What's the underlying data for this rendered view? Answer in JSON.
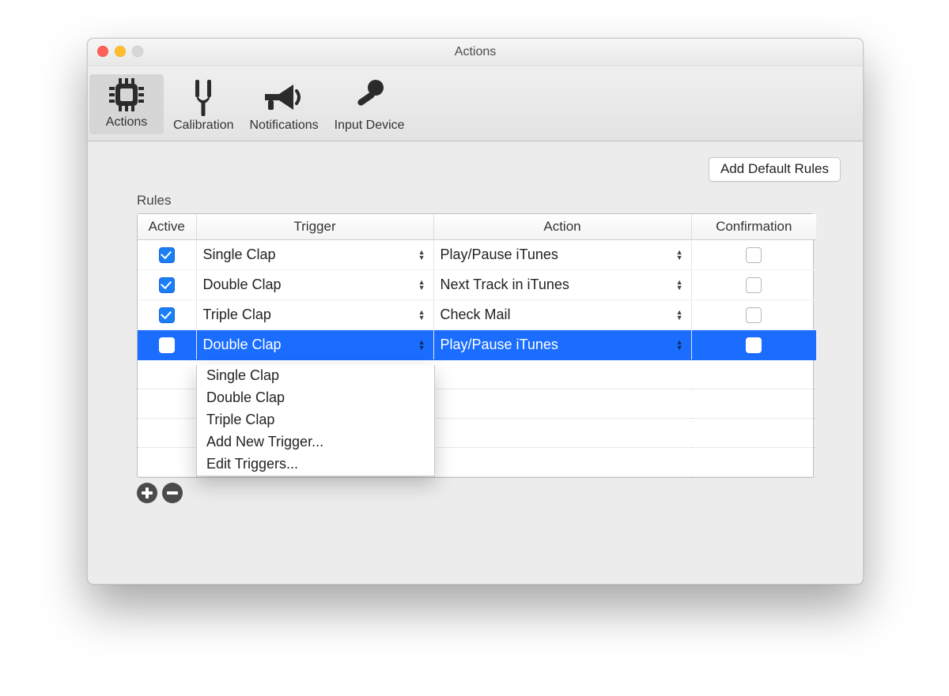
{
  "window": {
    "title": "Actions"
  },
  "toolbar": {
    "items": [
      {
        "label": "Actions"
      },
      {
        "label": "Calibration"
      },
      {
        "label": "Notifications"
      },
      {
        "label": "Input Device"
      }
    ]
  },
  "buttons": {
    "add_default_rules": "Add Default Rules"
  },
  "rules": {
    "label": "Rules",
    "columns": {
      "active": "Active",
      "trigger": "Trigger",
      "action": "Action",
      "confirmation": "Confirmation"
    },
    "rows": [
      {
        "active": true,
        "trigger": "Single Clap",
        "action": "Play/Pause iTunes",
        "confirmation": false,
        "selected": false
      },
      {
        "active": true,
        "trigger": "Double Clap",
        "action": "Next Track in iTunes",
        "confirmation": false,
        "selected": false
      },
      {
        "active": true,
        "trigger": "Triple Clap",
        "action": "Check Mail",
        "confirmation": false,
        "selected": false
      },
      {
        "active": true,
        "trigger": "Double Clap",
        "action": "Play/Pause iTunes",
        "confirmation": false,
        "selected": true
      }
    ]
  },
  "trigger_menu": {
    "options": [
      "Single Clap",
      "Double Clap",
      "Triple Clap",
      "Add New Trigger...",
      "Edit Triggers..."
    ]
  }
}
